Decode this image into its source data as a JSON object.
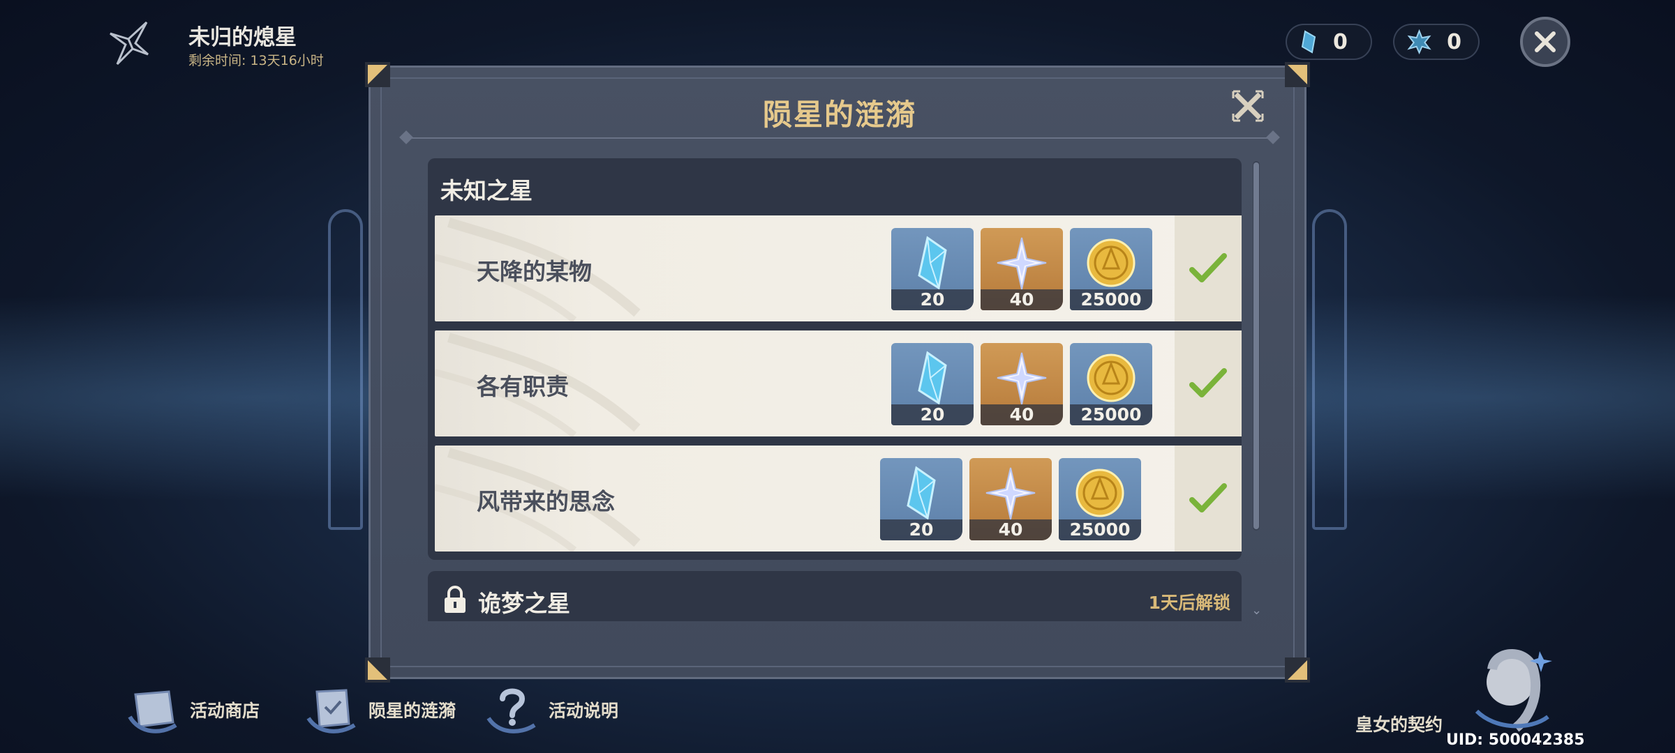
{
  "event": {
    "title": "未归的熄星",
    "time_left": "剩余时间: 13天16小时"
  },
  "currencies": [
    {
      "icon": "starglitter-shard-icon",
      "value": "0"
    },
    {
      "icon": "star-token-icon",
      "value": "0"
    }
  ],
  "dialog": {
    "title": "陨星的涟漪",
    "sections": [
      {
        "title": "未知之星",
        "quests": [
          {
            "name": "天降的某物",
            "rewards": [
              "20",
              "40",
              "25000"
            ],
            "completed": true
          },
          {
            "name": "各有职责",
            "rewards": [
              "20",
              "40",
              "25000"
            ],
            "completed": true
          },
          {
            "name": "风带来的思念",
            "rewards": [
              "20",
              "40",
              "25000"
            ],
            "completed": true
          }
        ]
      },
      {
        "title": "诡梦之星",
        "locked": true,
        "unlock_note": "1天后解锁"
      }
    ],
    "reward_icons": [
      "crystal-icon",
      "primogem-star-icon",
      "mora-coin-icon"
    ]
  },
  "nav": {
    "shop": "活动商店",
    "ripples": "陨星的涟漪",
    "help": "活动说明",
    "contract": "皇女的契约"
  },
  "uid": "UID: 500042385",
  "colors": {
    "title_gold": "#e6c98c",
    "check_green": "#7ab33a",
    "panel": "#454e60"
  }
}
